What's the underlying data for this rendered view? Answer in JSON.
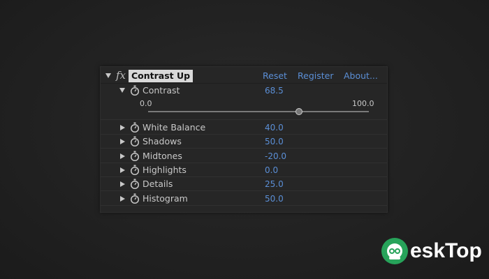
{
  "effect": {
    "fx_label": "fx",
    "name": "Contrast Up",
    "links": {
      "reset": "Reset",
      "register": "Register",
      "about": "About..."
    }
  },
  "contrast": {
    "label": "Contrast",
    "value": "68.5",
    "slider_min": "0.0",
    "slider_max": "100.0",
    "slider_fraction": 0.685
  },
  "params": [
    {
      "label": "White Balance",
      "value": "40.0"
    },
    {
      "label": "Shadows",
      "value": "50.0"
    },
    {
      "label": "Midtones",
      "value": "-20.0"
    },
    {
      "label": "Highlights",
      "value": "0.0"
    },
    {
      "label": "Details",
      "value": "25.0"
    },
    {
      "label": "Histogram",
      "value": "50.0"
    }
  ],
  "colors": {
    "link_blue": "#5b8fd6",
    "label_gray": "#c9c9c9",
    "brand_green": "#27a35a"
  },
  "icons": {
    "expand": "triangle-down",
    "collapsed": "triangle-right",
    "stopwatch": "stopwatch"
  },
  "watermark": {
    "text": "eskTop"
  }
}
